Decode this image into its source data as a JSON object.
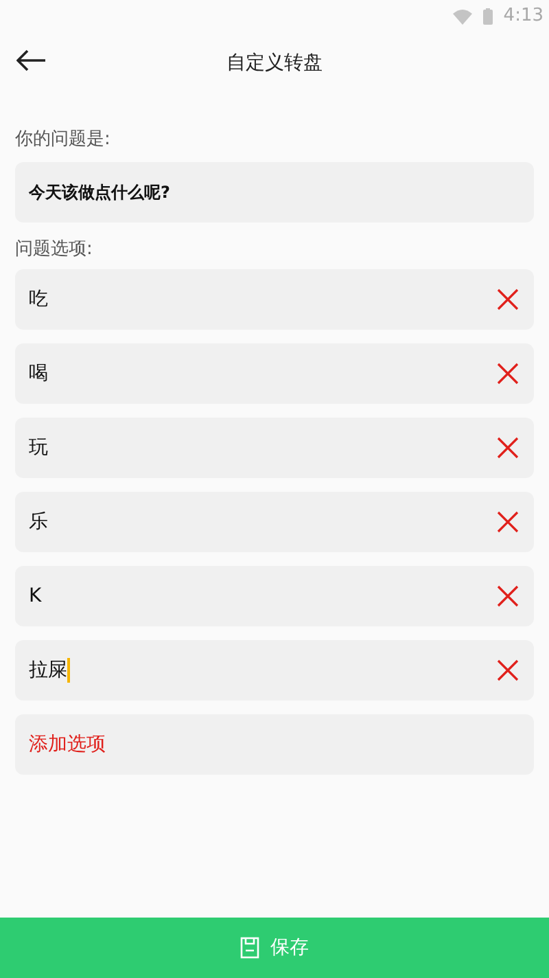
{
  "status_bar": {
    "time": "4:13"
  },
  "header": {
    "title": "自定义转盘"
  },
  "question": {
    "label": "你的问题是:",
    "value": "今天该做点什么呢?"
  },
  "options_label": "问题选项:",
  "options": [
    {
      "value": "吃",
      "focused": false
    },
    {
      "value": "喝",
      "focused": false
    },
    {
      "value": "玩",
      "focused": false
    },
    {
      "value": "乐",
      "focused": false
    },
    {
      "value": "K",
      "focused": false
    },
    {
      "value": "拉屎",
      "focused": true
    }
  ],
  "add_button": "添加选项",
  "save_button": "保存"
}
